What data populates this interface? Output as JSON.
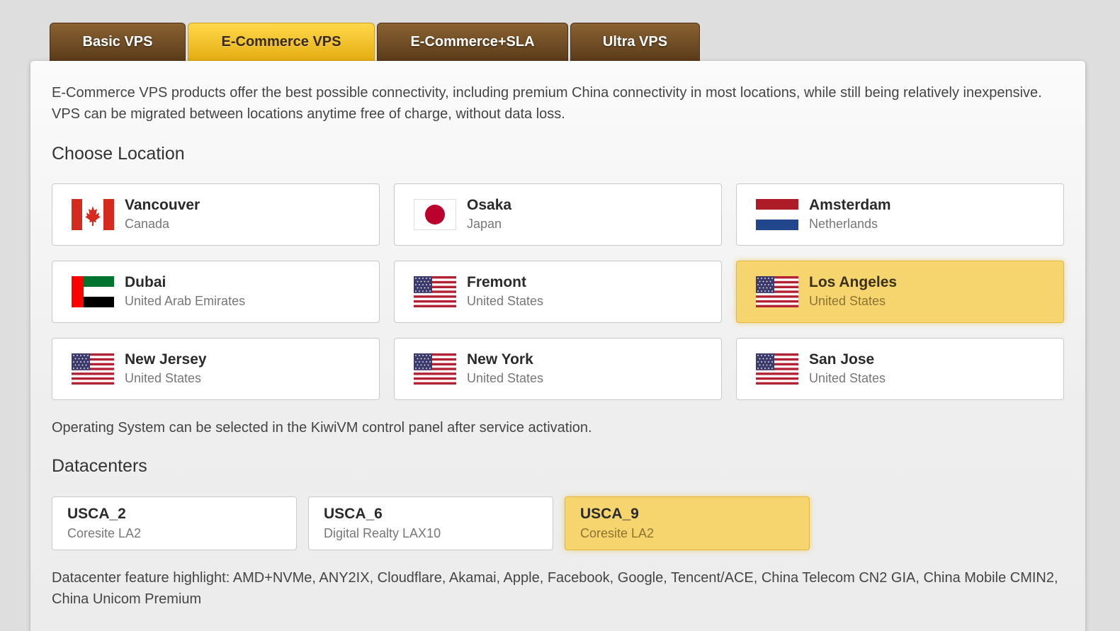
{
  "tabs": [
    {
      "label": "Basic VPS",
      "active": false
    },
    {
      "label": "E-Commerce VPS",
      "active": true
    },
    {
      "label": "E-Commerce+SLA",
      "active": false
    },
    {
      "label": "Ultra VPS",
      "active": false
    }
  ],
  "description": "E-Commerce VPS products offer the best possible connectivity, including premium China connectivity in most locations, while still being relatively inexpensive. VPS can be migrated between locations anytime free of charge, without data loss.",
  "location_heading": "Choose Location",
  "locations": [
    {
      "city": "Vancouver",
      "country": "Canada",
      "flag": "canada-flag-icon",
      "selected": false
    },
    {
      "city": "Osaka",
      "country": "Japan",
      "flag": "japan-flag-icon",
      "selected": false
    },
    {
      "city": "Amsterdam",
      "country": "Netherlands",
      "flag": "netherlands-flag-icon",
      "selected": false
    },
    {
      "city": "Dubai",
      "country": "United Arab Emirates",
      "flag": "uae-flag-icon",
      "selected": false
    },
    {
      "city": "Fremont",
      "country": "United States",
      "flag": "usa-flag-icon",
      "selected": false
    },
    {
      "city": "Los Angeles",
      "country": "United States",
      "flag": "usa-flag-icon",
      "selected": true
    },
    {
      "city": "New Jersey",
      "country": "United States",
      "flag": "usa-flag-icon",
      "selected": false
    },
    {
      "city": "New York",
      "country": "United States",
      "flag": "usa-flag-icon",
      "selected": false
    },
    {
      "city": "San Jose",
      "country": "United States",
      "flag": "usa-flag-icon",
      "selected": false
    }
  ],
  "os_note": "Operating System can be selected in the KiwiVM control panel after service activation.",
  "datacenter_heading": "Datacenters",
  "datacenters": [
    {
      "name": "USCA_2",
      "facility": "Coresite LA2",
      "selected": false
    },
    {
      "name": "USCA_6",
      "facility": "Digital Realty LAX10",
      "selected": false
    },
    {
      "name": "USCA_9",
      "facility": "Coresite LA2",
      "selected": true
    }
  ],
  "feature_highlight": "Datacenter feature highlight: AMD+NVMe, ANY2IX, Cloudflare, Akamai, Apple, Facebook, Google, Tencent/ACE, China Telecom CN2 GIA, China Mobile CMIN2, China Unicom Premium",
  "colors": {
    "tab_brown": "#6f4b22",
    "tab_gold": "#f2c42a",
    "selected_card": "#f6d56e"
  }
}
